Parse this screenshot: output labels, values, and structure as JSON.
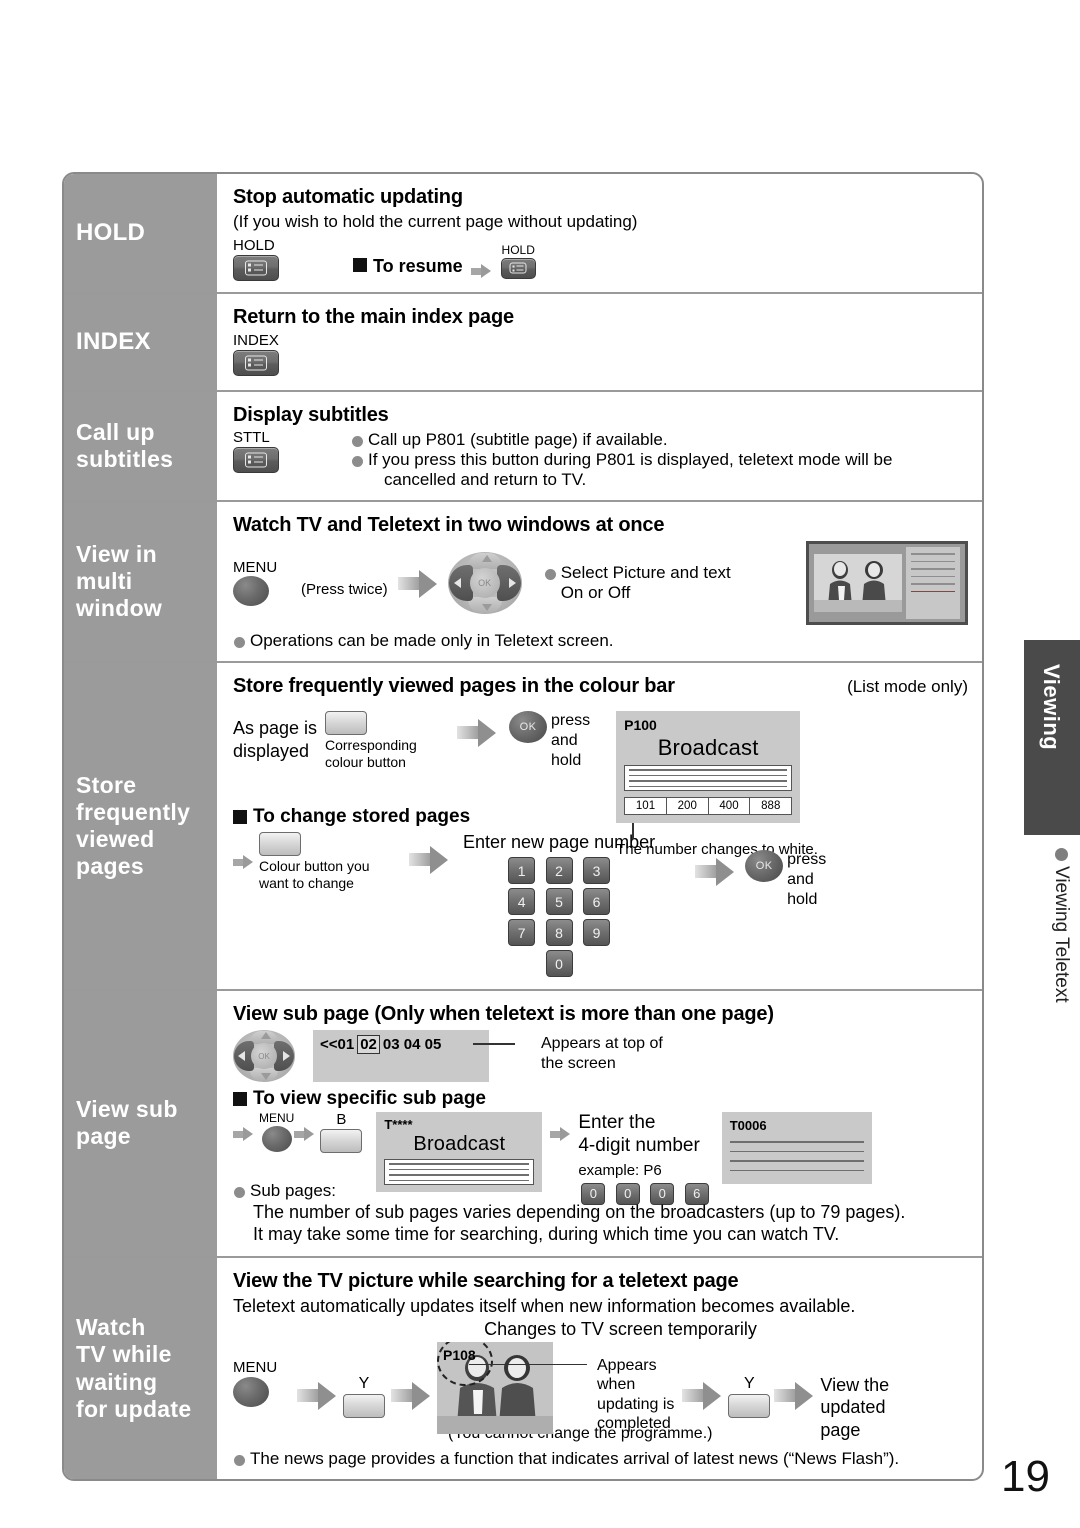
{
  "page": {
    "number": "19"
  },
  "side": {
    "tab_label": "Viewing",
    "sub_label": "Viewing Teletext"
  },
  "rows": [
    {
      "label": "HOLD",
      "heading": "Stop automatic updating",
      "subtext": "(If you wish to hold the current page without updating)",
      "key_caption": "HOLD",
      "resume_label": "To resume",
      "resume_key_caption": "HOLD"
    },
    {
      "label": "INDEX",
      "heading": "Return to the main index page",
      "key_caption": "INDEX"
    },
    {
      "label": "Call up\nsubtitles",
      "label_line1": "Call up",
      "label_line2": "subtitles",
      "heading": "Display subtitles",
      "key_caption": "STTL",
      "bullets": [
        "Call up P801 (subtitle page) if available.",
        "If you press this button during P801 is displayed, teletext mode will be",
        "cancelled and return to TV."
      ]
    },
    {
      "label_line1": "View in",
      "label_line2": "multi",
      "label_line3": "window",
      "heading": "Watch TV and Teletext in two windows at once",
      "menu_caption": "MENU",
      "press_twice": "(Press twice)",
      "select_line1": "Select Picture and text",
      "select_line2": "On or Off",
      "bullet": "Operations can be made only in Teletext screen."
    },
    {
      "label_line1": "Store",
      "label_line2": "frequently",
      "label_line3": "viewed",
      "label_line4": "pages",
      "heading": "Store frequently viewed pages in the colour bar",
      "mode_note": "(List mode only)",
      "as_page_is": "As page is",
      "displayed": "displayed",
      "corresponding_line1": "Corresponding",
      "corresponding_line2": "colour button",
      "ok_label": "OK",
      "press_and_hold": [
        "press",
        "and",
        "hold"
      ],
      "screen_page": "P100",
      "screen_title": "Broadcast",
      "colour_bar": [
        "101",
        "200",
        "400",
        "888"
      ],
      "white_note": "The number changes to white.",
      "change_heading": "To change stored pages",
      "enter_new_page": "Enter new page number",
      "colour_change_line1": "Colour button you",
      "colour_change_line2": "want to change",
      "numpad": [
        "1",
        "2",
        "3",
        "4",
        "5",
        "6",
        "7",
        "8",
        "9",
        "0"
      ],
      "ok_label2": "OK",
      "press_and_hold2": [
        "press",
        "and",
        "hold"
      ]
    },
    {
      "label_line1": "View sub",
      "label_line2": "page",
      "heading": "View sub page (Only when teletext is more than one page)",
      "subpage_strip_prefix": "<<01",
      "subpage_selected": "02",
      "subpage_rest": "03 04 05",
      "appears_line1": "Appears at top of",
      "appears_line2": "the screen",
      "specific_heading": "To view specific sub page",
      "menu_caption": "MENU",
      "b_key": "B",
      "screen1_page": "T****",
      "screen1_title": "Broadcast",
      "enter_line1": "Enter the",
      "enter_line2": "4-digit number",
      "example": "example: P6",
      "example_digits": [
        "0",
        "0",
        "0",
        "6"
      ],
      "screen2_page": "T0006",
      "bullet_head": "Sub pages:",
      "bullet_line1": "The number of sub pages varies depending on the broadcasters (up to 79 pages).",
      "bullet_line2": "It may take some time for searching, during which time you can watch TV."
    },
    {
      "label_line1": "Watch",
      "label_line2": "TV while",
      "label_line3": "waiting",
      "label_line4": "for update",
      "heading": "View the TV picture while searching for a teletext page",
      "subtext": "Teletext automatically updates itself when new information becomes available.",
      "changes_note": "Changes to TV screen temporarily",
      "menu_caption": "MENU",
      "y_key": "Y",
      "screen_page": "P108",
      "appears_lines": [
        "Appears",
        "when",
        "updating is",
        "completed"
      ],
      "y_key2": "Y",
      "view_updated": [
        "View the",
        "updated",
        "page"
      ],
      "cannot_change": "(You cannot change the programme.)",
      "bullet": "The news page provides a function that indicates arrival of latest news (“News Flash”)."
    }
  ]
}
